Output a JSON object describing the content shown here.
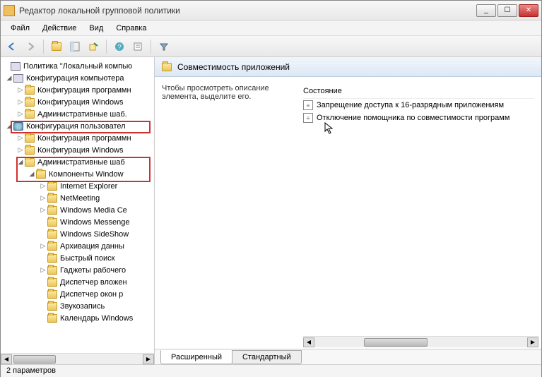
{
  "window": {
    "title": "Редактор локальной групповой политики"
  },
  "menu": {
    "file": "Файл",
    "action": "Действие",
    "view": "Вид",
    "help": "Справка"
  },
  "tree": {
    "root": "Политика \"Локальный компью",
    "comp_config": "Конфигурация компьютера",
    "comp_software": "Конфигурация программн",
    "comp_windows": "Конфигурация Windows",
    "comp_admin": "Административные шаб.",
    "user_config": "Конфигурация пользовател",
    "user_software": "Конфигурация программн",
    "user_windows": "Конфигурация Windows",
    "user_admin": "Административные шаб",
    "win_components": "Компоненты Window",
    "ie": "Internet Explorer",
    "netmeeting": "NetMeeting",
    "wmc": "Windows Media Ce",
    "wmsg": "Windows Messenge",
    "sideshow": "Windows SideShow",
    "archive": "Архивация данны",
    "quicksearch": "Быстрый поиск",
    "gadgets": "Гаджеты рабочего",
    "attach_mgr": "Диспетчер вложен",
    "window_mgr": "Диспетчер окон р",
    "sound_rec": "Звукозапись",
    "calendar": "Календарь Windows"
  },
  "content": {
    "heading": "Совместимость приложений",
    "description": "Чтобы просмотреть описание элемента, выделите его.",
    "state_header": "Состояние",
    "item1": "Запрещение доступа к 16-разрядным приложениям",
    "item2": "Отключение помощника по совместимости программ"
  },
  "tabs": {
    "ext": "Расширенный",
    "std": "Стандартный"
  },
  "status": "2 параметров"
}
